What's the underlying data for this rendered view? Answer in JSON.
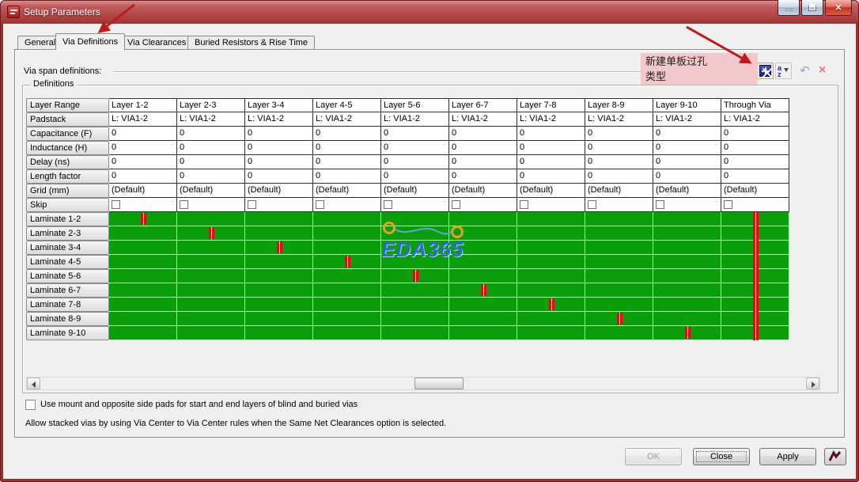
{
  "window": {
    "title": "Setup Parameters"
  },
  "tabs": [
    {
      "label": "General"
    },
    {
      "label": "Via Definitions"
    },
    {
      "label": "Via Clearances"
    },
    {
      "label": "Buried Resistors & Rise Time"
    }
  ],
  "via_span": {
    "label": "Via span definitions:"
  },
  "callout": {
    "line1": "新建单板过孔",
    "line2": "类型"
  },
  "toolbar": {
    "sort_a": "a",
    "sort_z": "z",
    "undo_glyph": "↶",
    "delete_glyph": "×"
  },
  "group": {
    "label": "Definitions"
  },
  "table": {
    "columns": [
      "Layer 1-2",
      "Layer 2-3",
      "Layer 3-4",
      "Layer 4-5",
      "Layer 5-6",
      "Layer 6-7",
      "Layer 7-8",
      "Layer 8-9",
      "Layer 9-10",
      "Through Via"
    ],
    "param_rows": [
      {
        "header": "Layer Range",
        "kind": "labels"
      },
      {
        "header": "Padstack",
        "kind": "text",
        "value": "L: VIA1-2"
      },
      {
        "header": "Capacitance (F)",
        "kind": "text",
        "value": "0"
      },
      {
        "header": "Inductance (H)",
        "kind": "text",
        "value": "0"
      },
      {
        "header": "Delay (ns)",
        "kind": "text",
        "value": "0"
      },
      {
        "header": "Length factor",
        "kind": "text",
        "value": "0"
      },
      {
        "header": "Grid (mm)",
        "kind": "text",
        "value": "(Default)"
      },
      {
        "header": "Skip",
        "kind": "checkbox"
      }
    ],
    "laminate_rows": [
      {
        "header": "Laminate 1-2",
        "marker_col": 0
      },
      {
        "header": "Laminate 2-3",
        "marker_col": 1
      },
      {
        "header": "Laminate 3-4",
        "marker_col": 2
      },
      {
        "header": "Laminate 4-5",
        "marker_col": 3
      },
      {
        "header": "Laminate 5-6",
        "marker_col": 4
      },
      {
        "header": "Laminate 6-7",
        "marker_col": 5
      },
      {
        "header": "Laminate 7-8",
        "marker_col": 6
      },
      {
        "header": "Laminate 8-9",
        "marker_col": 7
      },
      {
        "header": "Laminate 9-10",
        "marker_col": 8
      }
    ],
    "through_via_col": 9
  },
  "watermark": {
    "text": "EDA365"
  },
  "footer": {
    "checkbox_label": "Use mount and opposite side pads for start and end layers of blind and buried vias",
    "note": "Allow stacked vias by using Via Center to Via Center rules when the Same Net Clearances option is selected."
  },
  "buttons": {
    "ok": "OK",
    "close": "Close",
    "apply": "Apply"
  },
  "colors": {
    "green": "#0a9e0a",
    "marker_red": "#d51313",
    "accent_blue": "#2b6bc8"
  }
}
